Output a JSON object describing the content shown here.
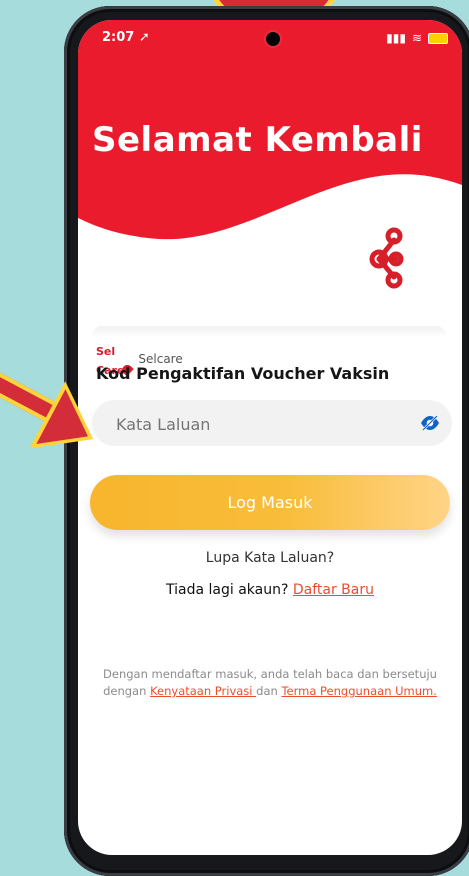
{
  "status_bar": {
    "time": "2:07",
    "location_icon": "location-arrow-icon",
    "signal_icon": "signal-icon",
    "wifi_icon": "wifi-icon",
    "battery_icon": "battery-icon"
  },
  "header": {
    "title": "Selamat Kembali"
  },
  "brand": {
    "logo_text": "Selcare",
    "logo_mark": "Sel\nCare",
    "section_title": "Kod Pengaktifan Voucher Vaksin"
  },
  "form": {
    "password_placeholder": "Kata Laluan",
    "password_value": "",
    "visibility_icon": "eye-off-icon",
    "login_button": "Log Masuk",
    "forgot_password": "Lupa Kata Laluan?",
    "signup_prefix": "Tiada lagi akaun? ",
    "signup_link": "Daftar Baru"
  },
  "legal": {
    "line1": "Dengan mendaftar masuk, anda telah baca dan bersetuju",
    "line2_prefix": "dengan ",
    "privacy_link": "Kenyataan Privasi ",
    "line2_middle": "dan ",
    "terms_link": "Terma Penggunaan Umum."
  },
  "colors": {
    "brand_red": "#ea1b2d",
    "accent_orange": "#f8b52d",
    "link_red": "#ee4d2d",
    "background": "#a6dcdc",
    "arrow_yellow": "#ffd43b"
  },
  "icons": {
    "share": "share-icon",
    "arrow": "red-arrow-icon"
  }
}
